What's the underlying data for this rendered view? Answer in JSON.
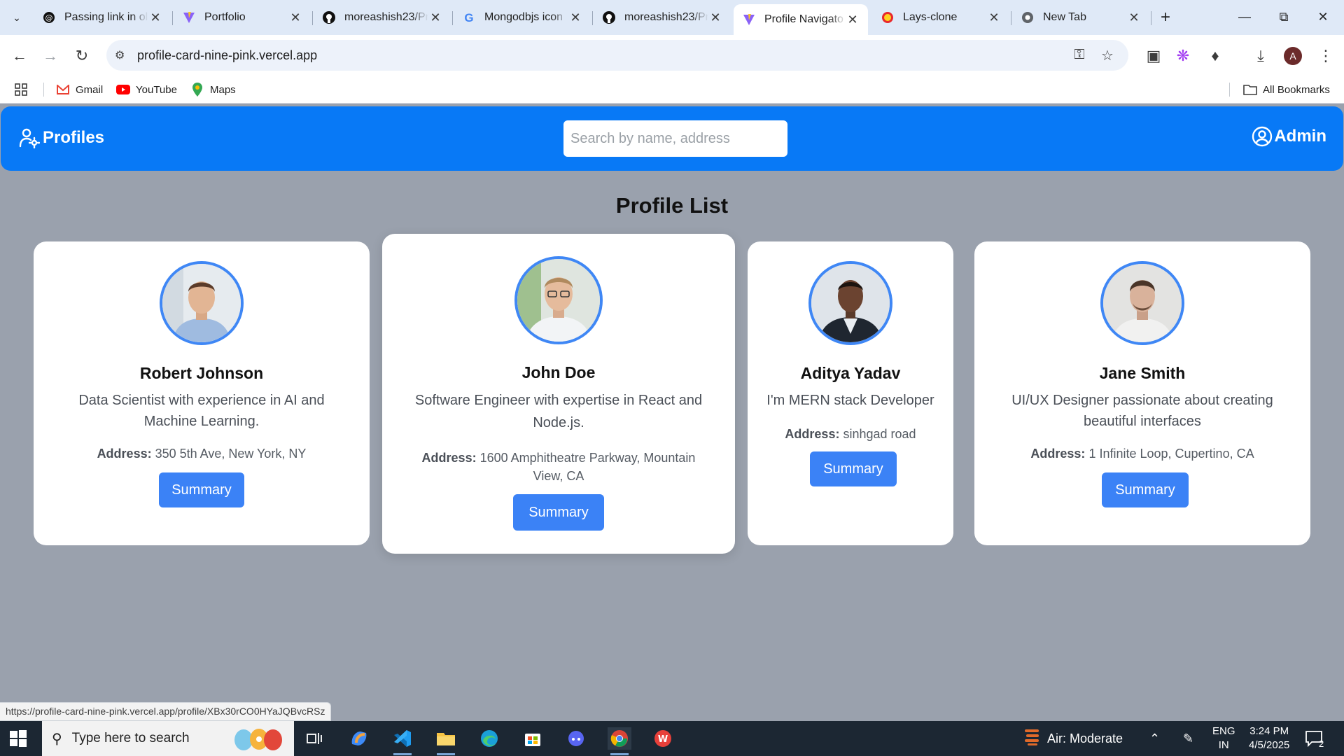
{
  "browser": {
    "tabs": [
      {
        "title": "Passing link in ol",
        "icon": "threads-icon"
      },
      {
        "title": "Portfolio",
        "icon": "vite-icon"
      },
      {
        "title": "moreashish23/Pr",
        "icon": "github-icon"
      },
      {
        "title": "Mongodbjs icon",
        "icon": "google-icon"
      },
      {
        "title": "moreashish23/Pr",
        "icon": "github-icon"
      },
      {
        "title": "Profile Navigato",
        "icon": "vite-icon",
        "active": true
      },
      {
        "title": "Lays-clone",
        "icon": "lays-icon"
      },
      {
        "title": "New Tab",
        "icon": "chrome-icon"
      }
    ],
    "url": "profile-card-nine-pink.vercel.app",
    "bookmarks": [
      {
        "label": "Gmail",
        "icon": "gmail-icon"
      },
      {
        "label": "YouTube",
        "icon": "youtube-icon"
      },
      {
        "label": "Maps",
        "icon": "maps-icon"
      }
    ],
    "all_bookmarks": "All Bookmarks",
    "profile_initial": "A",
    "status_url": "https://profile-card-nine-pink.vercel.app/profile/XBx30rCO0HYaJQBvcRSz"
  },
  "app": {
    "brand": "Profiles",
    "search_placeholder": "Search by name, address",
    "admin_label": "Admin",
    "page_title": "Profile List",
    "address_label": "Address:",
    "profiles": [
      {
        "name": "Robert Johnson",
        "description": "Data Scientist with experience in AI and Machine Learning.",
        "address": "350 5th Ave, New York, NY",
        "button": "Summary"
      },
      {
        "name": "John Doe",
        "description": "Software Engineer with expertise in React and Node.js.",
        "address": "1600 Amphitheatre Parkway, Mountain View, CA",
        "button": "Summary"
      },
      {
        "name": "Aditya Yadav",
        "description": "I'm MERN stack Developer",
        "address": "sinhgad road",
        "button": "Summary"
      },
      {
        "name": "Jane Smith",
        "description": "UI/UX Designer passionate about creating beautiful interfaces",
        "address": "1 Infinite Loop, Cupertino, CA",
        "button": "Summary"
      }
    ]
  },
  "taskbar": {
    "search_placeholder": "Type here to search",
    "weather": "Air: Moderate",
    "lang_top": "ENG",
    "lang_bottom": "IN",
    "time": "3:24 PM",
    "date": "4/5/2025",
    "notifications": "2"
  },
  "colors": {
    "navbar": "#0879f6",
    "page_bg": "#9aa1ad",
    "button": "#3b82f6",
    "avatar_ring": "#3f87f5"
  }
}
